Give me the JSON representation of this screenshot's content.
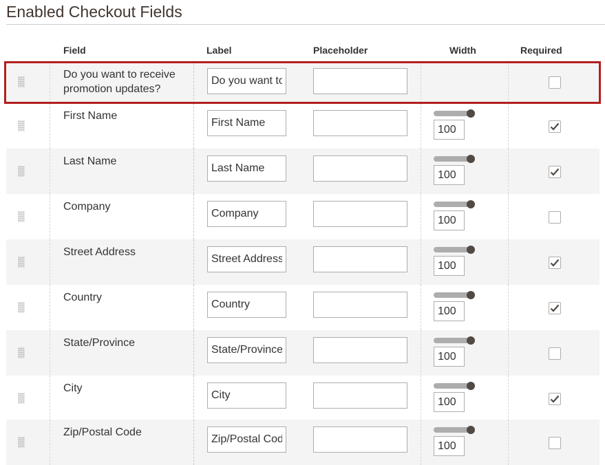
{
  "section": {
    "title": "Enabled Checkout Fields"
  },
  "columns": {
    "field": "Field",
    "label": "Label",
    "placeholder": "Placeholder",
    "width": "Width",
    "required": "Required"
  },
  "highlight_color": "#b31e1e",
  "rows": [
    {
      "field": "Do you want to receive promotion updates?",
      "label": "Do you want to receive promotion updates?",
      "placeholder": "",
      "width": null,
      "required": false
    },
    {
      "field": "First Name",
      "label": "First Name",
      "placeholder": "",
      "width": "100",
      "required": true
    },
    {
      "field": "Last Name",
      "label": "Last Name",
      "placeholder": "",
      "width": "100",
      "required": true
    },
    {
      "field": "Company",
      "label": "Company",
      "placeholder": "",
      "width": "100",
      "required": false
    },
    {
      "field": "Street Address",
      "label": "Street Address",
      "placeholder": "",
      "width": "100",
      "required": true
    },
    {
      "field": "Country",
      "label": "Country",
      "placeholder": "",
      "width": "100",
      "required": true
    },
    {
      "field": "State/Province",
      "label": "State/Province",
      "placeholder": "",
      "width": "100",
      "required": false
    },
    {
      "field": "City",
      "label": "City",
      "placeholder": "",
      "width": "100",
      "required": true
    },
    {
      "field": "Zip/Postal Code",
      "label": "Zip/Postal Code",
      "placeholder": "",
      "width": "100",
      "required": false
    }
  ]
}
